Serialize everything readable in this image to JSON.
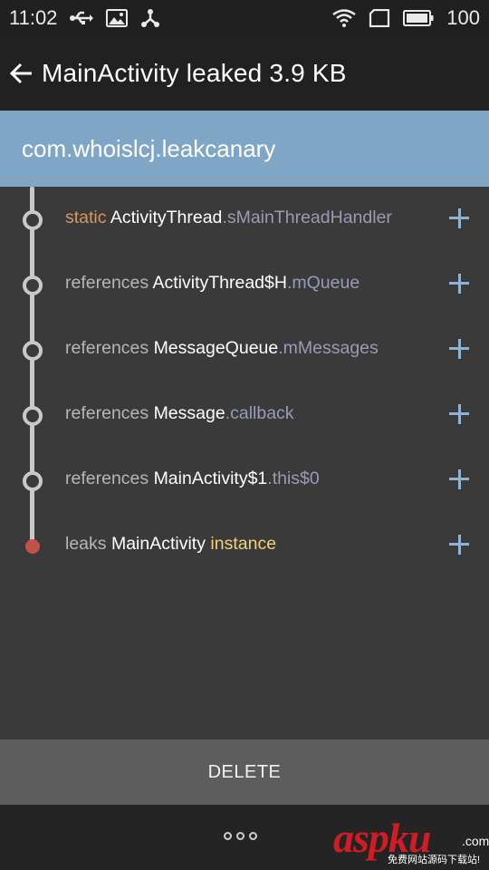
{
  "status_bar": {
    "time": "11:02",
    "battery": "100",
    "icons_left": [
      "usb-icon",
      "image-icon",
      "share-icon"
    ],
    "icons_right": [
      "wifi-icon",
      "sim-icon",
      "battery-icon"
    ]
  },
  "app_bar": {
    "title": "MainActivity leaked 3.9 KB",
    "back_icon": "arrow-left-icon"
  },
  "package_header": {
    "name": "com.whoislcj.leakcanary"
  },
  "trace": [
    {
      "keyword": "static",
      "class": "ActivityThread",
      "field": ".sMainThreadHandler",
      "type": "node"
    },
    {
      "keyword": "references",
      "class": "ActivityThread$H",
      "field": ".mQueue",
      "type": "node"
    },
    {
      "keyword": "references",
      "class": "MessageQueue",
      "field": ".mMessages",
      "type": "node"
    },
    {
      "keyword": "references",
      "class": "Message",
      "field": ".callback",
      "type": "node"
    },
    {
      "keyword": "references",
      "class": "MainActivity$1",
      "field": ".this$0",
      "type": "node"
    },
    {
      "keyword": "leaks",
      "class": "MainActivity",
      "field": "instance",
      "type": "leak"
    }
  ],
  "delete_button": {
    "label": "DELETE"
  },
  "bottom_bar": {
    "more_icon": "more-dots-icon"
  },
  "watermark": {
    "main": "aspku",
    "com": ".com",
    "sub": "免费网站源码下载站!"
  },
  "colors": {
    "accent": "#7fa7c5",
    "leak": "#c0524a",
    "static_keyword": "#d69a5f",
    "field": "#9a9ab8",
    "instance": "#f0d27a"
  }
}
